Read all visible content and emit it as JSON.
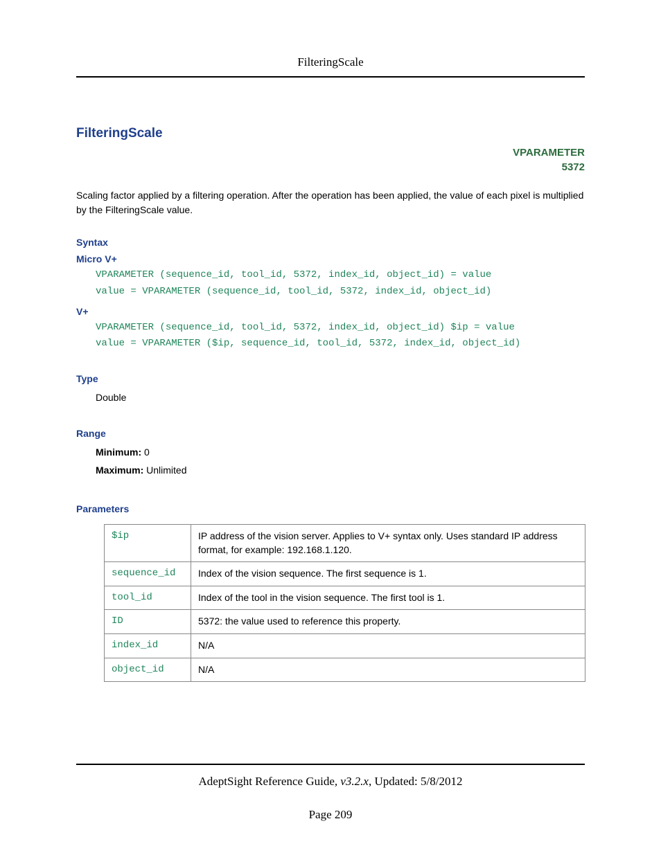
{
  "running_header": "FilteringScale",
  "topic": {
    "title": "FilteringScale",
    "vparam_label": "VPARAMETER",
    "vparam_code": "5372"
  },
  "description": "Scaling factor applied by a filtering operation. After the operation has been applied, the value of each pixel is multiplied by the FilteringScale value.",
  "syntax": {
    "heading": "Syntax",
    "micro_label": "Micro V+",
    "micro_lines": [
      "VPARAMETER (sequence_id, tool_id, 5372, index_id, object_id) = value",
      "value = VPARAMETER (sequence_id, tool_id, 5372, index_id, object_id)"
    ],
    "vplus_label": "V+",
    "vplus_lines": [
      "VPARAMETER (sequence_id, tool_id, 5372, index_id, object_id) $ip = value",
      "value = VPARAMETER ($ip, sequence_id, tool_id, 5372, index_id, object_id)"
    ]
  },
  "type": {
    "heading": "Type",
    "value": "Double"
  },
  "range": {
    "heading": "Range",
    "min_label": "Minimum:",
    "min_value": "0",
    "max_label": "Maximum:",
    "max_value": "Unlimited"
  },
  "parameters": {
    "heading": "Parameters",
    "rows": [
      {
        "name": "$ip",
        "desc": "IP address of the vision server. Applies to V+ syntax only. Uses standard IP address format, for example: 192.168.1.120."
      },
      {
        "name": "sequence_id",
        "desc": "Index of the vision sequence. The first sequence is 1."
      },
      {
        "name": "tool_id",
        "desc": "Index of the tool in the vision sequence. The first tool is 1."
      },
      {
        "name": "ID",
        "desc": "5372: the value used to reference this property."
      },
      {
        "name": "index_id",
        "desc": "N/A"
      },
      {
        "name": "object_id",
        "desc": "N/A"
      }
    ]
  },
  "footer": {
    "guide_title": "AdeptSight Reference Guide",
    "version": "v3.2.x",
    "updated_label": "Updated:",
    "updated_date": "5/8/2012",
    "page_label": "Page",
    "page_number": "209"
  }
}
